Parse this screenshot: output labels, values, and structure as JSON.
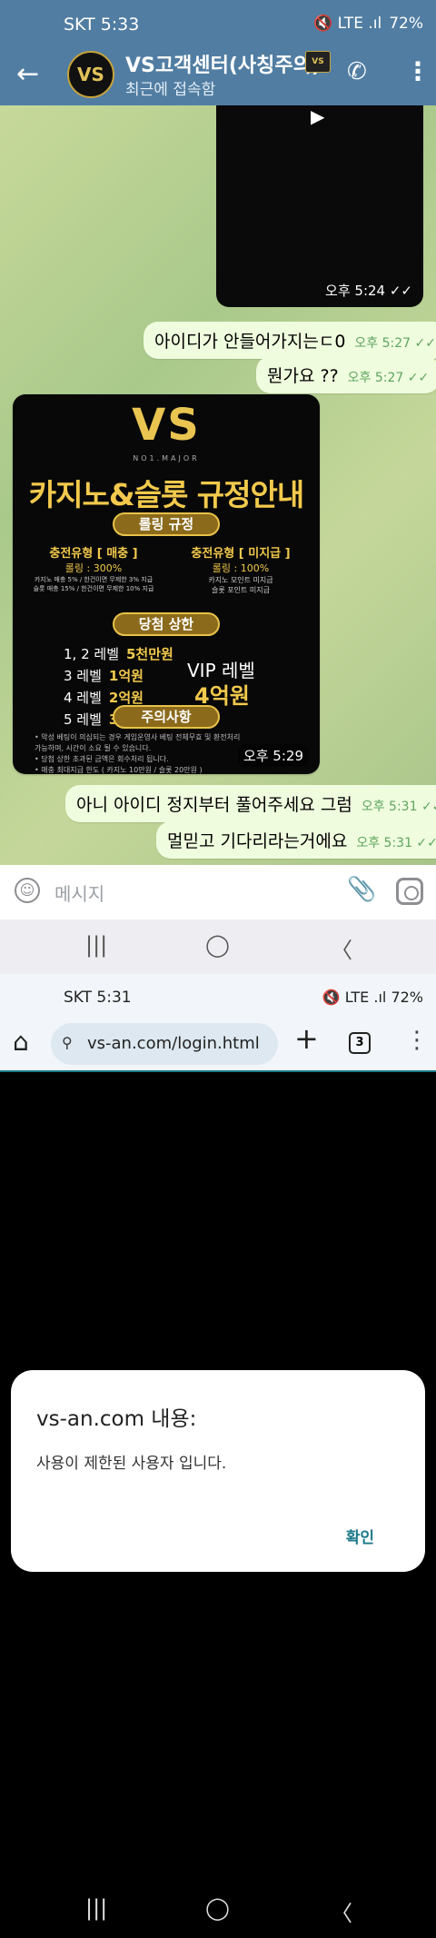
{
  "chat_screen": {
    "status_bar": {
      "time": "SKT 5:33",
      "icons": "🔇 LTE .ıl",
      "battery": "72%"
    },
    "header": {
      "avatar_text": "VS",
      "title": "VS고객센터(사칭주의)",
      "badge_text": "VS",
      "subtitle": "최근에 접속함"
    },
    "video": {
      "time": "오후 5:24 ✓✓"
    },
    "messages": [
      {
        "text": "아이디가 안들어가지는ㄷ0",
        "meta": "오후 5:27 ✓✓"
      },
      {
        "text": "뭔가요 ??",
        "meta": "오후 5:27 ✓✓"
      },
      {
        "text": "아니 아이디 정지부터 풀어주세요 그럼",
        "meta": "오후 5:31 ✓✓"
      },
      {
        "text": "멀믿고 기다리라는거에요",
        "meta": "오후 5:31 ✓✓"
      }
    ],
    "poster": {
      "logo": "VS",
      "logo_sub": "NO1.MAJOR",
      "headline": "카지노&슬롯 규정안내",
      "pill1": "롤링 규정",
      "left_title": "충전유형 [ 매충 ]",
      "left_l1": "롤링 : 300%",
      "left_l2": "카지노 매충 5% / 한건이면 무제한 3% 지급",
      "left_l3": "슬롯 매충 15% / 한건이면 무제한 10% 지급",
      "right_title": "충전유형 [ 미지급 ]",
      "right_l1": "롤링 : 100%",
      "right_l2": "카지노 모인트 미지급",
      "right_l3": "슬롯 포인트 미지급",
      "pill2": "당첨 상한",
      "levels": [
        {
          "label": "1, 2 레벨",
          "value": "5천만원"
        },
        {
          "label": "3 레벨",
          "value": "1억원"
        },
        {
          "label": "4 레벨",
          "value": "2억원"
        },
        {
          "label": "5 레벨",
          "value": "3억원"
        }
      ],
      "vip_label": "VIP 레벨",
      "vip_value": "4억원",
      "pill3": "주의사항",
      "notes": [
        "• 악성 베팅이 의심되는 경우 게임운영사 베팅 전체무효 및 환전처리 가능하며, 시간이 소요 될 수 있습니다.",
        "• 당첨 상한 초과된 금액은 회수처리 됩니다.",
        "• 매충 최대지급 한도 ( 카지노 10만원 / 슬롯 20만원 )"
      ],
      "time": "오후 5:29"
    },
    "input": {
      "placeholder": "메시지"
    }
  },
  "browser_screen": {
    "status_bar": {
      "time": "SKT 5:31",
      "icons": "🔇 LTE .ıl 72%"
    },
    "url": "vs-an.com/login.html",
    "tab_count": "3",
    "dialog": {
      "title": "vs-an.com 내용:",
      "message": "사용이 제한된 사용자 입니다.",
      "ok_label": "확인"
    }
  },
  "nav_icons": {
    "recents": "|||",
    "home": "◯",
    "back": "〈"
  }
}
